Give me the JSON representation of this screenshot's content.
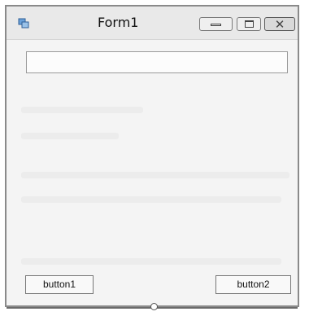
{
  "window": {
    "title": "Form1",
    "icon": "form-icon",
    "controls": {
      "minimize_icon": "minimize-icon",
      "maximize_icon": "maximize-icon",
      "close_glyph": "✕"
    }
  },
  "form": {
    "textbox": {
      "value": "",
      "placeholder": ""
    },
    "buttons": [
      {
        "label": "button1"
      },
      {
        "label": "button2"
      }
    ]
  },
  "colors": {
    "window_border": "#8a8a8a",
    "titlebar_bg": "#e9e9e9",
    "client_bg": "#f4f4f4"
  }
}
